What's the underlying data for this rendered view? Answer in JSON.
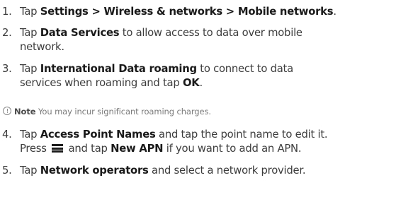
{
  "steps": [
    {
      "number": "1.",
      "lines": [
        [
          {
            "t": "Tap ",
            "b": false
          },
          {
            "t": "Settings > Wireless & networks > Mobile networks",
            "b": true
          },
          {
            "t": ".",
            "b": false
          }
        ]
      ]
    },
    {
      "number": "2.",
      "lines": [
        [
          {
            "t": "Tap ",
            "b": false
          },
          {
            "t": "Data Services",
            "b": true
          },
          {
            "t": " to allow access to data over mobile",
            "b": false
          }
        ],
        [
          {
            "t": "network.",
            "b": false
          }
        ]
      ]
    },
    {
      "number": "3.",
      "lines": [
        [
          {
            "t": "Tap ",
            "b": false
          },
          {
            "t": "International Data roaming",
            "b": true
          },
          {
            "t": " to connect to data",
            "b": false
          }
        ],
        [
          {
            "t": "services when roaming and tap ",
            "b": false
          },
          {
            "t": "OK",
            "b": true
          },
          {
            "t": ".",
            "b": false
          }
        ]
      ]
    },
    {
      "number": "4.",
      "lines": [
        [
          {
            "t": "Tap ",
            "b": false
          },
          {
            "t": "Access Point Names",
            "b": true
          },
          {
            "t": " and tap the point name to edit it.",
            "b": false
          }
        ],
        [
          {
            "t": "Press ",
            "b": false
          },
          {
            "icon": "menu-icon"
          },
          {
            "t": " and tap ",
            "b": false
          },
          {
            "t": "New APN",
            "b": true
          },
          {
            "t": " if you want to add an APN.",
            "b": false
          }
        ]
      ]
    },
    {
      "number": "5.",
      "lines": [
        [
          {
            "t": "Tap ",
            "b": false
          },
          {
            "t": "Network operators",
            "b": true
          },
          {
            "t": " and select a network provider.",
            "b": false
          }
        ]
      ]
    }
  ],
  "note": {
    "icon": "info-icon",
    "label": "Note",
    "text": " You may incur significant roaming charges."
  },
  "colors": {
    "body_text": "#3d3d3d",
    "bold_text": "#1a1a1a",
    "note_text": "#7a7a7a"
  }
}
